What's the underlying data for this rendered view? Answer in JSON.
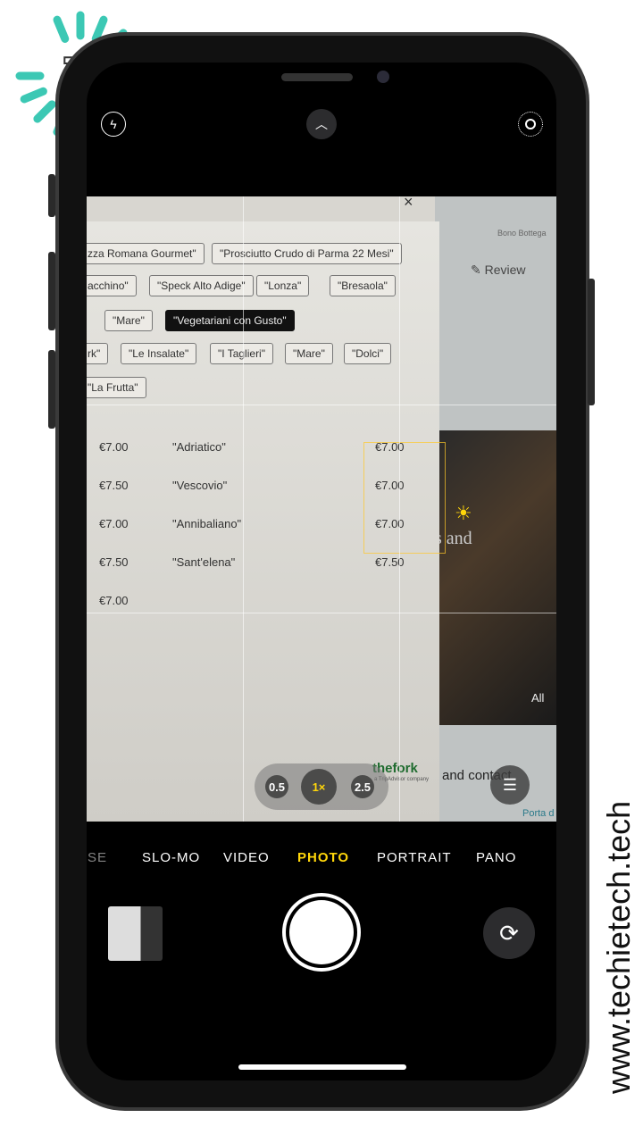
{
  "logo": {
    "letter": "T",
    "accent": "#3cc8b4"
  },
  "watermark": "www.techietech.tech",
  "top": {
    "flash_icon": "flash-icon",
    "chevron_icon": "chevron-up-icon",
    "live_icon": "live-photo-icon"
  },
  "viewfinder": {
    "close": "×",
    "chips": [
      "zza Romana Gourmet\"",
      "\"Prosciutto Crudo di Parma 22 Mesi\"",
      "acchino\"",
      "\"Speck Alto Adige\"",
      "\"Lonza\"",
      "\"Bresaola\"",
      "\"Mare\"",
      "\"Vegetariani con Gusto\"",
      "rk\"",
      "\"Le Insalate\"",
      "\"I Taglieri\"",
      "\"Mare\"",
      "\"Dolci\"",
      "\"La Frutta\""
    ],
    "rows": [
      {
        "price": "€7.00",
        "name": "\"Adriatico\"",
        "price2": "€7.00"
      },
      {
        "price": "€7.50",
        "name": "\"Vescovio\"",
        "price2": "€7.00"
      },
      {
        "price": "€7.00",
        "name": "\"Annibaliano\"",
        "price2": "€7.00"
      },
      {
        "price": "€7.50",
        "name": "\"Sant'elena\"",
        "price2": "€7.50"
      },
      {
        "price": "€7.00"
      }
    ],
    "bg_texts": {
      "shop": "Bono Bottega",
      "review": "Review",
      "and": "s and",
      "all": "All",
      "contact": "and contact",
      "porta": "Porta d",
      "brand": "thefork",
      "brand_sub": "a TripAdvisor company"
    }
  },
  "zoom_levels": [
    {
      "label": "0.5"
    },
    {
      "label": "1×",
      "active": true
    },
    {
      "label": "2.5"
    }
  ],
  "modes": [
    {
      "label": "PSE"
    },
    {
      "label": "SLO-MO"
    },
    {
      "label": "VIDEO"
    },
    {
      "label": "PHOTO",
      "active": true
    },
    {
      "label": "PORTRAIT"
    },
    {
      "label": "PANO"
    }
  ],
  "colors": {
    "active": "#ffd60a"
  }
}
